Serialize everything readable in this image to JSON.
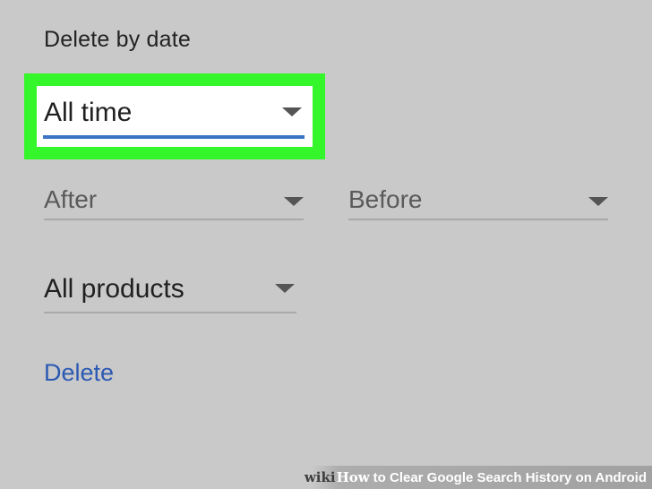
{
  "section": {
    "title": "Delete by date"
  },
  "date_range": {
    "selected": "All time",
    "after_label": "After",
    "before_label": "Before"
  },
  "products": {
    "selected": "All products"
  },
  "actions": {
    "delete_label": "Delete"
  },
  "watermark": {
    "brand_prefix": "wiki",
    "brand_suffix": "How",
    "article_title": "to Clear Google Search History on Android"
  },
  "colors": {
    "background": "#c9c9c9",
    "highlight": "#35f52b",
    "active_underline": "#3b73c5",
    "link": "#2a59b3"
  },
  "icons": {
    "dropdown": "chevron-down-icon"
  }
}
